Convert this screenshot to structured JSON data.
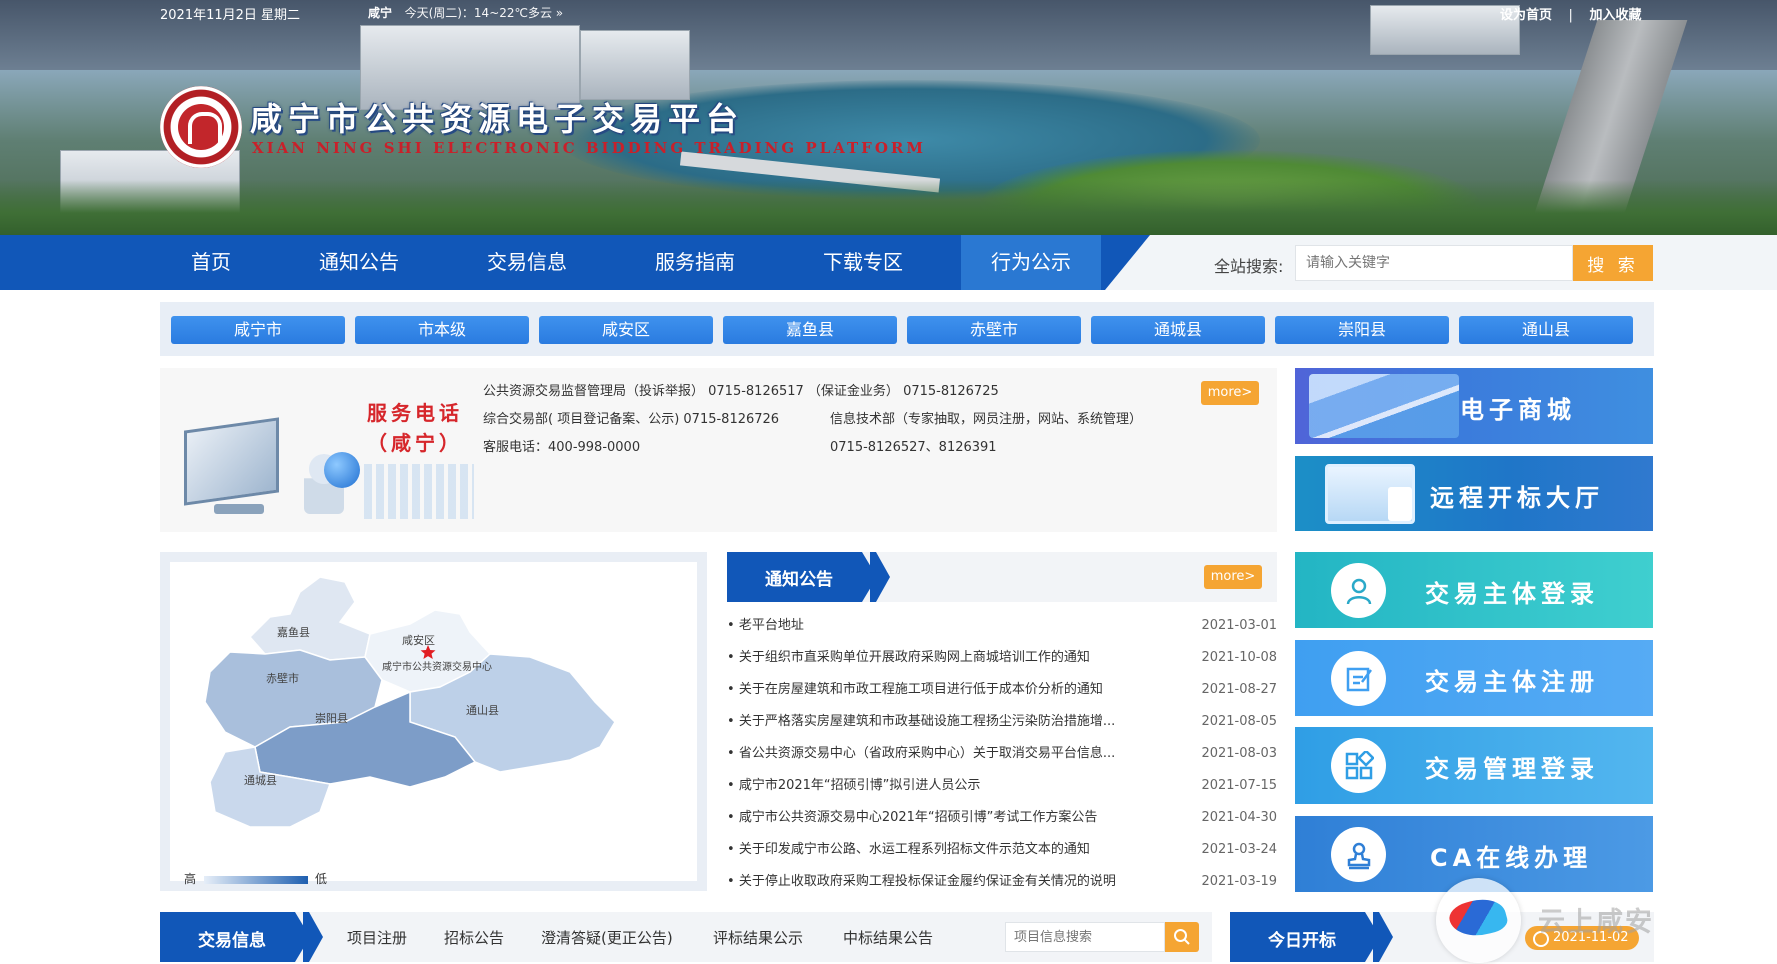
{
  "topbar": {
    "date": "2021年11月2日 星期二",
    "weather_city": "咸宁",
    "weather_text": "今天(周二)：14~22℃多云 »",
    "set_home": "设为首页",
    "separator": "|",
    "add_favorite": "加入收藏"
  },
  "header": {
    "title": "咸宁市公共资源电子交易平台",
    "subtitle": "XIAN NING SHI ELECTRONIC BIDDING TRADING PLATFORM"
  },
  "nav": {
    "items": [
      "首页",
      "通知公告",
      "交易信息",
      "服务指南",
      "下载专区",
      "行为公示"
    ],
    "active_index": 5,
    "search_label": "全站搜索:",
    "search_placeholder": "请输入关键字",
    "search_button": "搜 索"
  },
  "districts": [
    "咸宁市",
    "市本级",
    "咸安区",
    "嘉鱼县",
    "赤壁市",
    "通城县",
    "崇阳县",
    "通山县"
  ],
  "phone": {
    "title_line1": "服务电话",
    "title_line2": "（咸宁）",
    "rows": [
      [
        "公共资源交易监督管理局（投诉举报） 0715-8126517 （保证金业务） 0715-8126725",
        ""
      ],
      [
        "综合交易部( 项目登记备案、公示) 0715-8126726",
        "信息技术部（专家抽取，网员注册，网站、系统管理）"
      ],
      [
        "客服电话：400-998-0000",
        "0715-8126527、8126391"
      ]
    ],
    "more": "more>"
  },
  "side_buttons": {
    "mall": "电子商城",
    "remote": "远程开标大厅",
    "login": "交易主体登录",
    "register": "交易主体注册",
    "manage": "交易管理登录",
    "ca": "CA在线办理"
  },
  "map": {
    "legend_high": "高",
    "legend_low": "低",
    "labels": {
      "jiayu": "嘉鱼县",
      "xianan": "咸安区",
      "center": "咸宁市公共资源交易中心",
      "chibi": "赤壁市",
      "chongyang": "崇阳县",
      "tongshan": "通山县",
      "tongcheng": "通城县"
    }
  },
  "notice": {
    "title": "通知公告",
    "more": "more>",
    "items": [
      {
        "title": "老平台地址",
        "date": "2021-03-01"
      },
      {
        "title": "关于组织市直采购单位开展政府采购网上商城培训工作的通知",
        "date": "2021-10-08"
      },
      {
        "title": "关于在房屋建筑和市政工程施工项目进行低于成本价分析的通知",
        "date": "2021-08-27"
      },
      {
        "title": "关于严格落实房屋建筑和市政基础设施工程扬尘污染防治措施增...",
        "date": "2021-08-05"
      },
      {
        "title": "省公共资源交易中心（省政府采购中心）关于取消交易平台信息...",
        "date": "2021-08-03"
      },
      {
        "title": "咸宁市2021年“招硕引博”拟引进人员公示",
        "date": "2021-07-15"
      },
      {
        "title": "咸宁市公共资源交易中心2021年“招硕引博”考试工作方案公告",
        "date": "2021-04-30"
      },
      {
        "title": "关于印发咸宁市公路、水运工程系列招标文件示范文本的通知",
        "date": "2021-03-24"
      },
      {
        "title": "关于停止收取政府采购工程投标保证金履约保证金有关情况的说明",
        "date": "2021-03-19"
      }
    ]
  },
  "trade": {
    "title": "交易信息",
    "subtabs": [
      "项目注册",
      "招标公告",
      "澄清答疑(更正公告)",
      "评标结果公示",
      "中标结果公告"
    ],
    "search_placeholder": "项目信息搜索"
  },
  "today": {
    "title": "今日开标",
    "date": "2021-11-02"
  },
  "watermark": "云上咸安"
}
